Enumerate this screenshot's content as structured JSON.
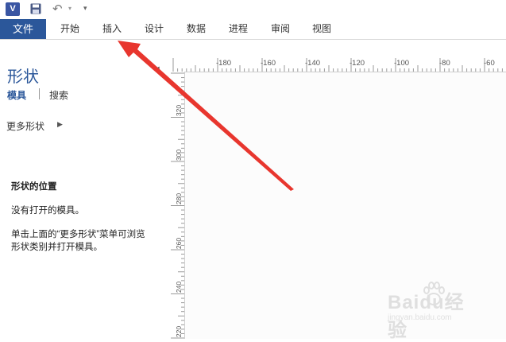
{
  "app": {
    "icon_letter": "V"
  },
  "ribbon": {
    "tabs": [
      "文件",
      "开始",
      "插入",
      "设计",
      "数据",
      "进程",
      "审阅",
      "视图"
    ]
  },
  "shapes_pane": {
    "title": "形状",
    "tab_stencils": "模具",
    "tab_search": "搜索",
    "more_shapes": "更多形状",
    "location_heading": "形状的位置",
    "no_stencils": "没有打开的模具。",
    "hint_line1": "单击上面的“更多形状”菜单可浏览",
    "hint_line2": "形状类别并打开模具。"
  },
  "ruler": {
    "h_labels": [
      "-180",
      "-160",
      "-140",
      "-120",
      "-100",
      "-80",
      "-60"
    ],
    "v_labels": [
      "320",
      "300",
      "280",
      "260",
      "240",
      "220"
    ]
  },
  "watermark": {
    "brand": "Baidu经验",
    "sub": "jingyan.baidu.com"
  },
  "colors": {
    "accent": "#2b579a",
    "arrow": "#e8362e"
  }
}
